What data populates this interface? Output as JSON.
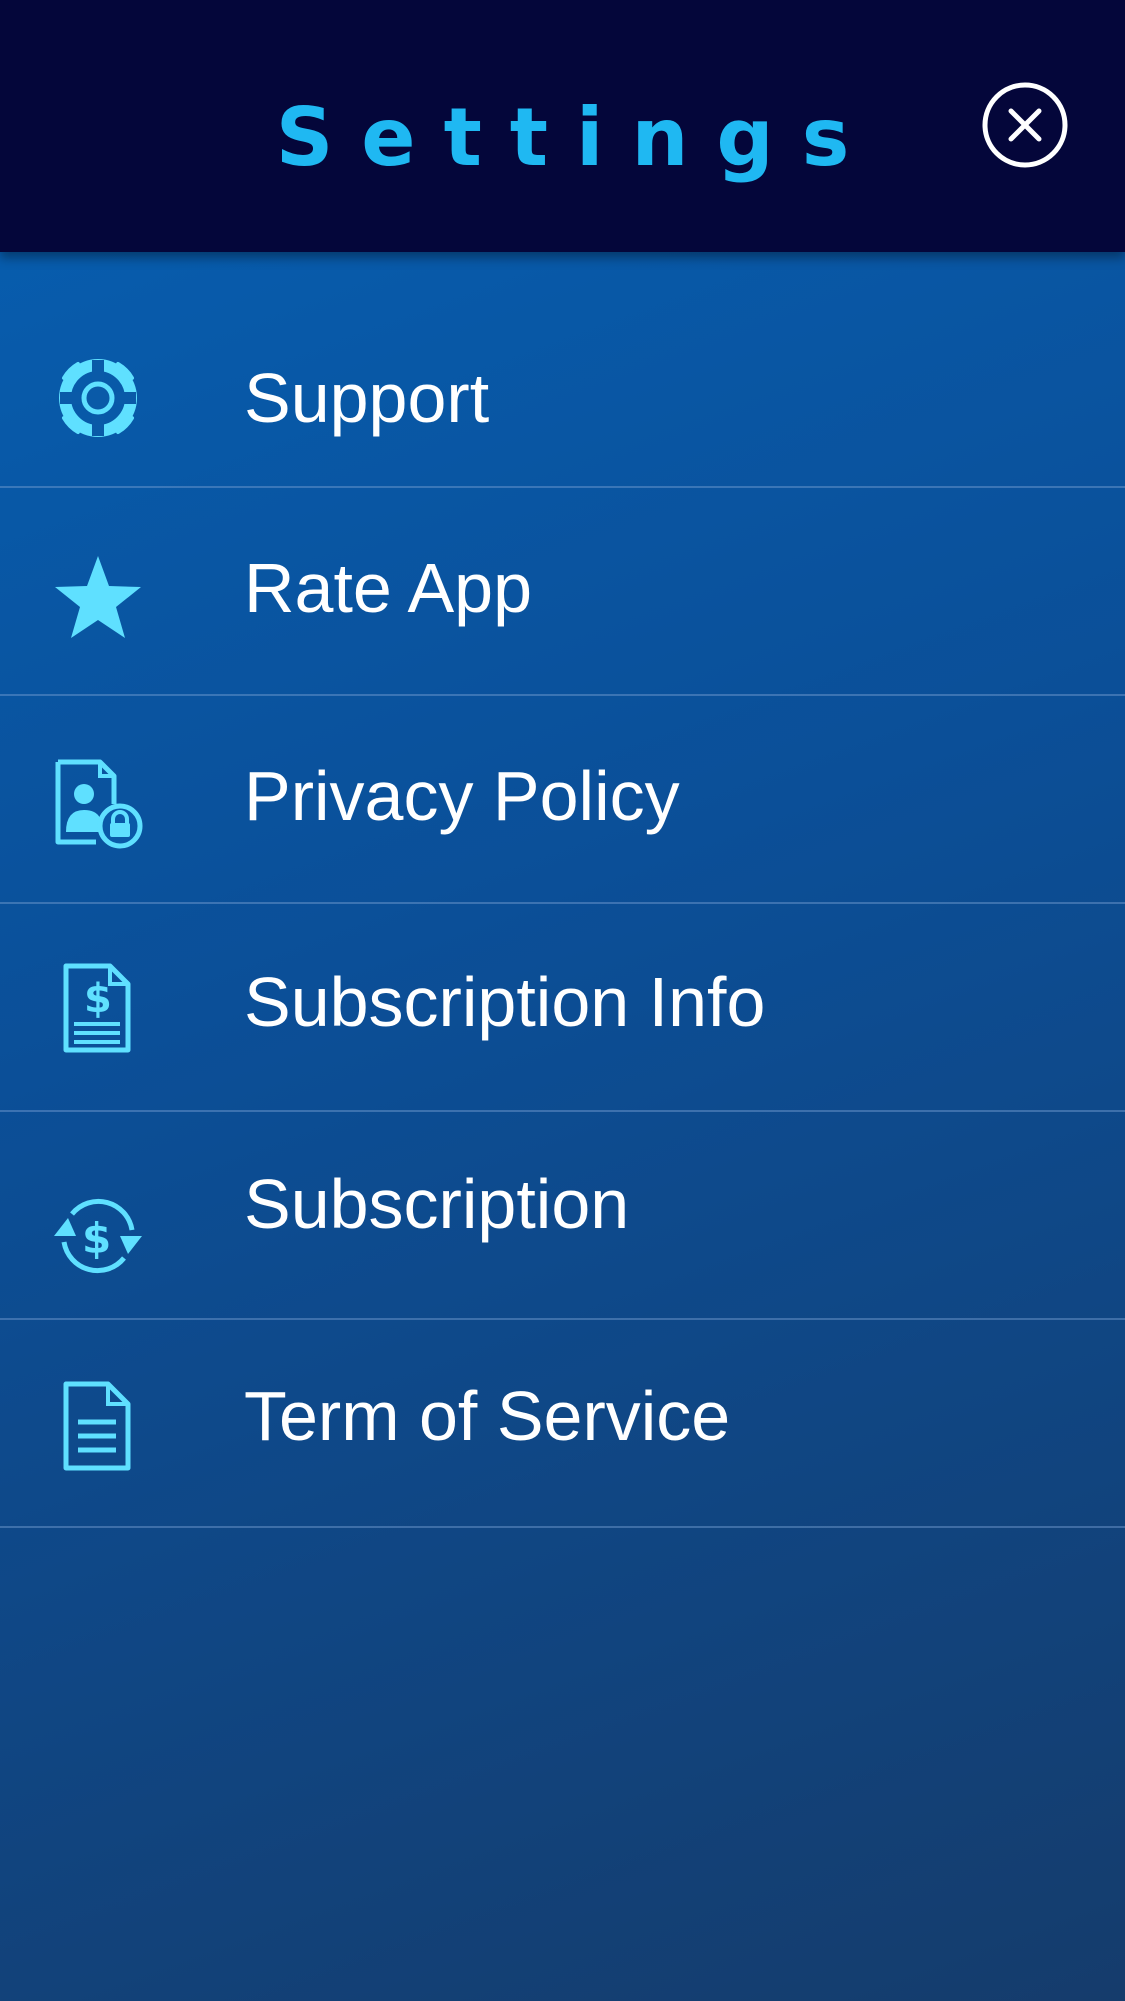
{
  "header": {
    "title": "Settings",
    "close_icon": "close-circle-icon"
  },
  "colors": {
    "header_bg": "#04063a",
    "title": "#1fb8f2",
    "icon": "#5fe0ff",
    "label": "#ffffff",
    "background_top": "#0660b3",
    "background_bottom": "#153c6c"
  },
  "menu": {
    "items": [
      {
        "label": "Support",
        "icon": "lifebuoy-icon"
      },
      {
        "label": "Rate App",
        "icon": "star-icon"
      },
      {
        "label": "Privacy Policy",
        "icon": "privacy-document-lock-icon"
      },
      {
        "label": "Subscription Info",
        "icon": "invoice-dollar-icon"
      },
      {
        "label": "Subscription",
        "icon": "recurring-dollar-icon"
      },
      {
        "label": "Term of Service",
        "icon": "document-icon"
      }
    ]
  }
}
